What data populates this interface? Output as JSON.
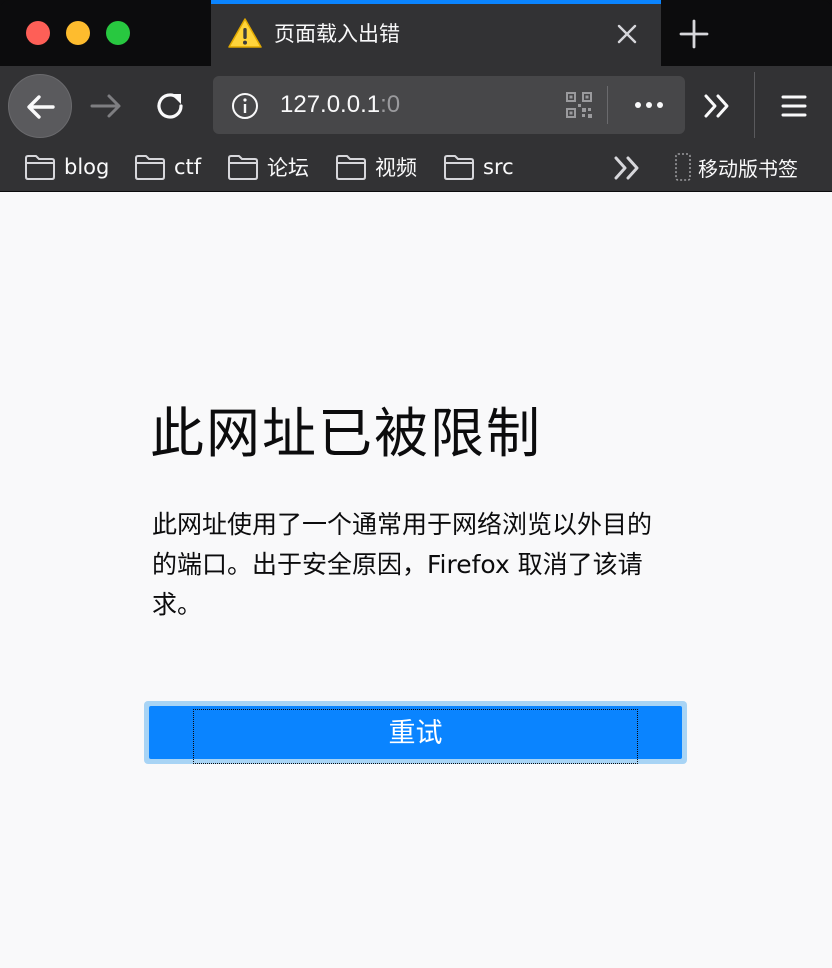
{
  "window": {
    "controls": {
      "close": "#fe5f57",
      "minimize": "#febc2e",
      "maximize": "#28c840"
    }
  },
  "tab": {
    "title": "页面载入出错",
    "icon": "warning-icon",
    "accent_color": "#0a84ff"
  },
  "toolbar": {
    "url_host": "127.0.0.1",
    "url_port": ":0",
    "icons": [
      "back-arrow-icon",
      "forward-arrow-icon",
      "reload-icon",
      "info-icon",
      "qr-code-icon",
      "more-dots-icon",
      "overflow-chevron-icon",
      "hamburger-menu-icon"
    ]
  },
  "bookmarks": {
    "items": [
      {
        "label": "blog",
        "icon": "folder-icon"
      },
      {
        "label": "ctf",
        "icon": "folder-icon"
      },
      {
        "label": "论坛",
        "icon": "folder-icon"
      },
      {
        "label": "视频",
        "icon": "folder-icon"
      },
      {
        "label": "src",
        "icon": "folder-icon"
      }
    ],
    "mobile_label": "移动版书签"
  },
  "error": {
    "title": "此网址已被限制",
    "description": "此网址使用了一个通常用于网络浏览以外目的的端口。出于安全原因，Firefox 取消了该请求。",
    "retry_label": "重试",
    "button_color": "#0a84ff"
  }
}
